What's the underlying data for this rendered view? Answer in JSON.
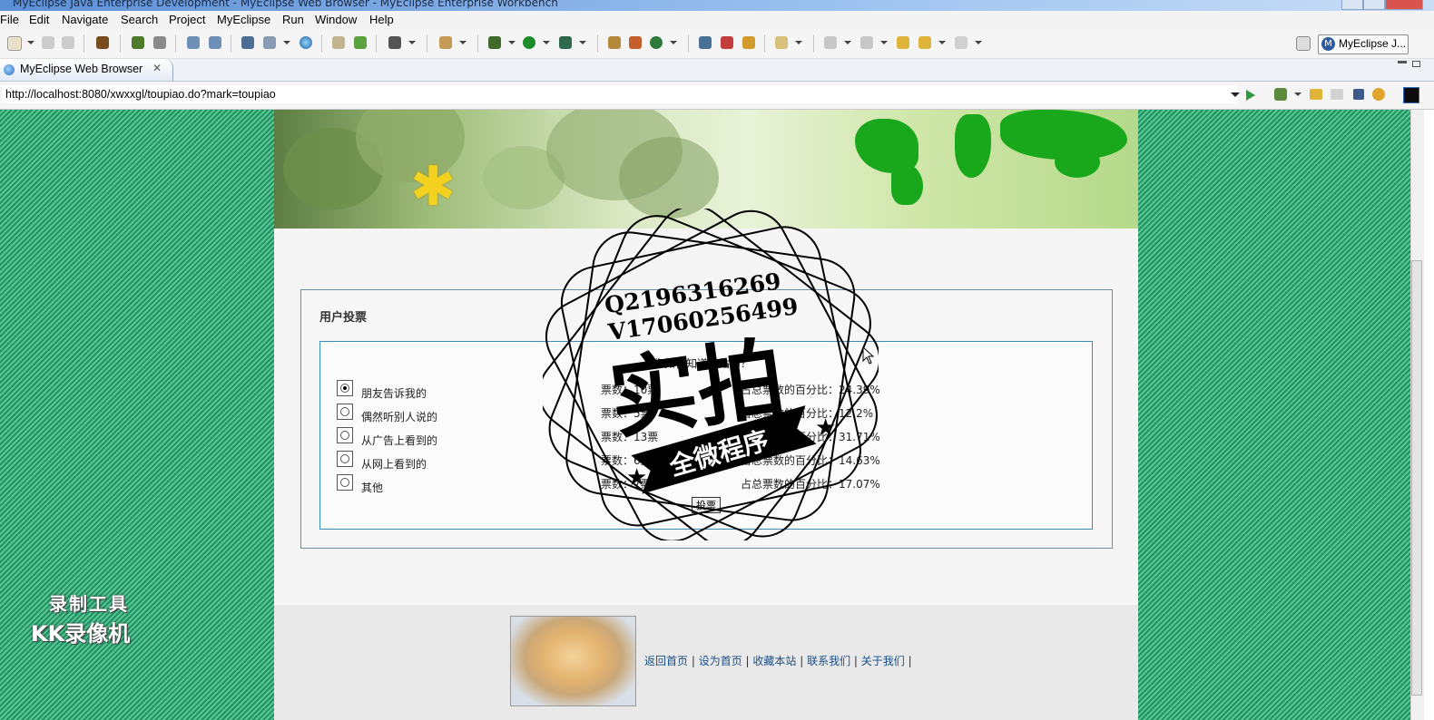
{
  "window": {
    "title": "MyEclipse Java Enterprise Development - MyEclipse Web Browser - MyEclipse Enterprise Workbench"
  },
  "menu": [
    "File",
    "Edit",
    "Navigate",
    "Search",
    "Project",
    "MyEclipse",
    "Run",
    "Window",
    "Help"
  ],
  "perspective": {
    "label": "MyEclipse J..."
  },
  "tab": {
    "label": "MyEclipse Web Browser"
  },
  "url": {
    "value": "http://localhost:8080/xwxxgl/toupiao.do?mark=toupiao"
  },
  "poll": {
    "title": "用户投票",
    "question": "您如何知道本站的？",
    "vote_button": "投票",
    "options": [
      {
        "label": "朋友告诉我的",
        "count": "票数：10票",
        "percent": "占总票数的百分比：24.39%",
        "selected": true
      },
      {
        "label": "偶然听别人说的",
        "count": "票数：5票",
        "percent": "占总票数的百分比：12.2%",
        "selected": false
      },
      {
        "label": "从广告上看到的",
        "count": "票数：13票",
        "percent": "占总票数的百分比：31.71%",
        "selected": false
      },
      {
        "label": "从网上看到的",
        "count": "票数：6票",
        "percent": "占总票数的百分比：14.63%",
        "selected": false
      },
      {
        "label": "其他",
        "count": "票数：7票",
        "percent": "占总票数的百分比：17.07%",
        "selected": false
      }
    ]
  },
  "footer": {
    "links": [
      "返回首页",
      "设为首页",
      "收藏本站",
      "联系我们",
      "关于我们"
    ],
    "separator": " | "
  },
  "watermark": {
    "line1": "录制工具",
    "line2": "KK录像机"
  },
  "stamp": {
    "contact1": "Q2196316269",
    "contact2": "V17060256499",
    "big": "实拍",
    "ribbon": "全微程序"
  }
}
